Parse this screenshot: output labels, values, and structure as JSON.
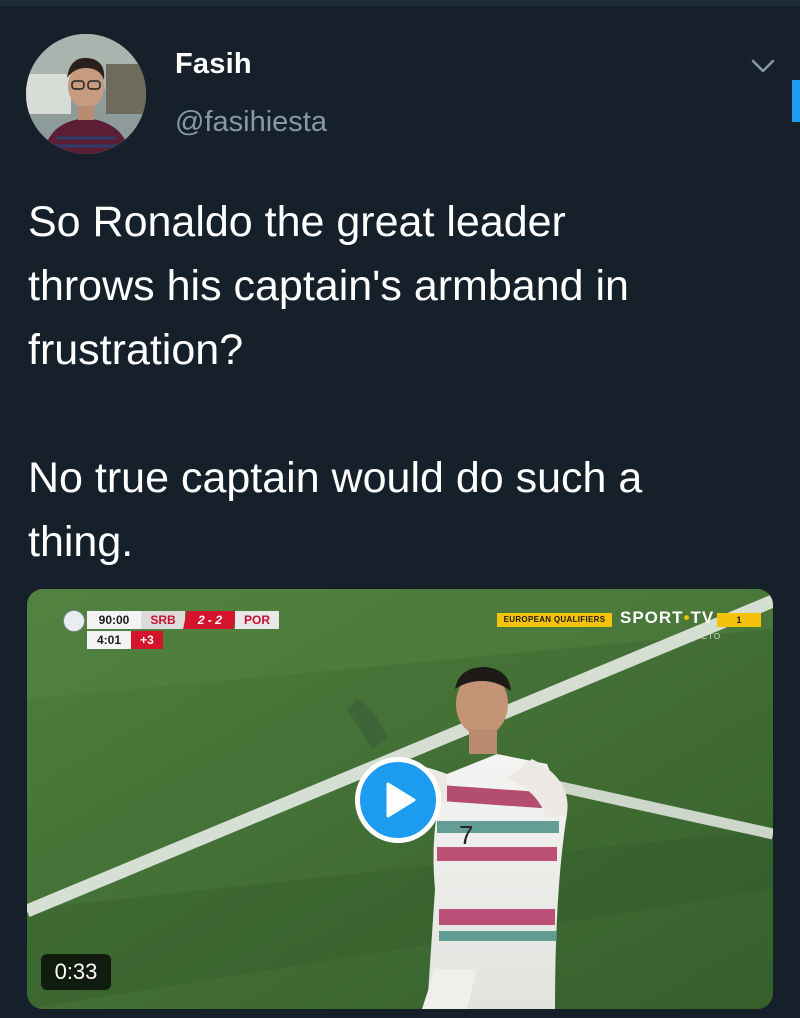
{
  "author": {
    "display_name": "Fasih",
    "handle": "@fasihiesta",
    "avatar_icon": "profile-photo"
  },
  "menu_icon": "chevron-down-icon",
  "tweet": {
    "text": "So Ronaldo the great leader\nthrows his captain's armband in\nfrustration?\n\nNo true captain would do such a\nthing."
  },
  "media": {
    "type": "video",
    "duration": "0:33",
    "play_icon": "play-icon",
    "scorebug": {
      "clock": "90:00",
      "home": "SRB",
      "score": "2 - 2",
      "away": "POR",
      "added_time_elapsed": "4:01",
      "added_time": "+3"
    },
    "broadcast": {
      "competition": "EUROPEAN QUALIFIERS",
      "channel_a": "SPORT",
      "channel_sep": "•",
      "channel_b": "TV",
      "channel_number": "1",
      "live_label": "DIRETO"
    },
    "player_shirt_number": "7"
  },
  "colors": {
    "background": "#15202b",
    "accent": "#1d9bf0",
    "secondary_text": "#8899a6"
  }
}
